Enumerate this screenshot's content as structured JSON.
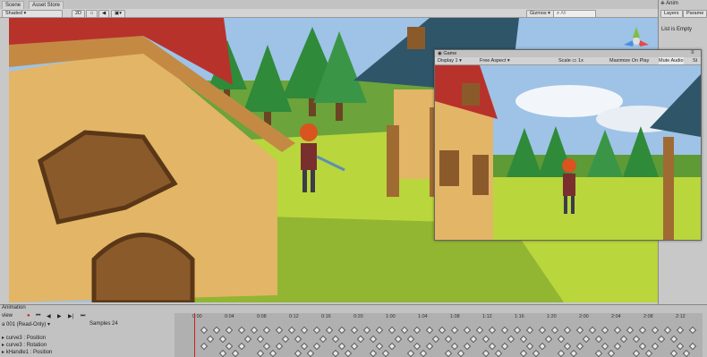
{
  "scene_panel": {
    "tabs": [
      "Scene",
      "Asset Store"
    ],
    "shading_mode": "Shaded",
    "mode_2d": "2D",
    "gizmos_label": "Gizmos",
    "search_placeholder": "All"
  },
  "animation_tab": "Animation",
  "inspector": {
    "tab": "Anim",
    "layers_label": "Layers",
    "params_label": "Parame",
    "list_empty": "List is Empty"
  },
  "game_window": {
    "tab": "Game",
    "display": "Display 1",
    "aspect": "Free Aspect",
    "scale_label": "Scale",
    "scale_value": "1x",
    "maximize_on_play": "Maximize On Play",
    "mute_audio": "Mute Audio",
    "stats": "St"
  },
  "animation": {
    "preview_label": "view",
    "clip_name": "a 001 (Read-Only)",
    "samples_label": "Samples",
    "samples_value": "24",
    "tracks": [
      "curve3 : Position",
      "curve3 : Rotation",
      "kHandle1 : Position"
    ],
    "timeline_ticks": [
      "0:00",
      "0:04",
      "0:08",
      "0:12",
      "0:16",
      "0:20",
      "1:00",
      "1:04",
      "1:08",
      "1:12",
      "1:16",
      "1:20",
      "2:00",
      "2:04",
      "2:08",
      "2:12"
    ]
  },
  "colors": {
    "grass": "#b9d63c",
    "wall": "#e3b567",
    "roof_red": "#b8322c",
    "roof_blue": "#2f5569",
    "tree": "#2f8a3a",
    "sky": "#9ec3e6"
  }
}
